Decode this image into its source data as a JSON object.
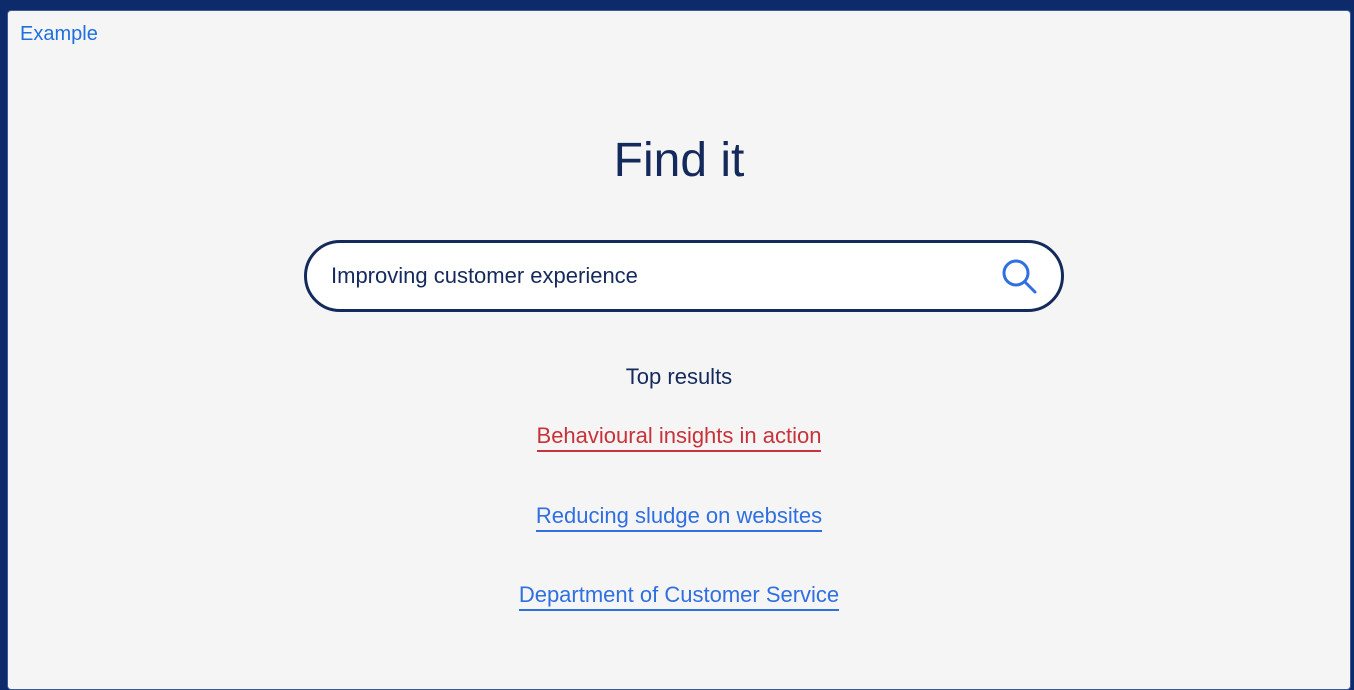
{
  "header": {
    "example_label": "Example"
  },
  "main": {
    "title": "Find it",
    "search": {
      "value": "Improving customer experience",
      "icon": "search-icon"
    },
    "results_heading": "Top results",
    "results": [
      {
        "label": "Behavioural insights in action",
        "color": "#c8323a"
      },
      {
        "label": "Reducing sludge on websites",
        "color": "#2f6fe0"
      },
      {
        "label": "Department of Customer Service",
        "color": "#2f6fe0"
      }
    ]
  },
  "colors": {
    "navy": "#152a5c",
    "link_blue": "#2f6fe0",
    "visited_red": "#c8323a",
    "page_bg": "#f5f5f5",
    "frame_bg": "#0d2b6b"
  }
}
